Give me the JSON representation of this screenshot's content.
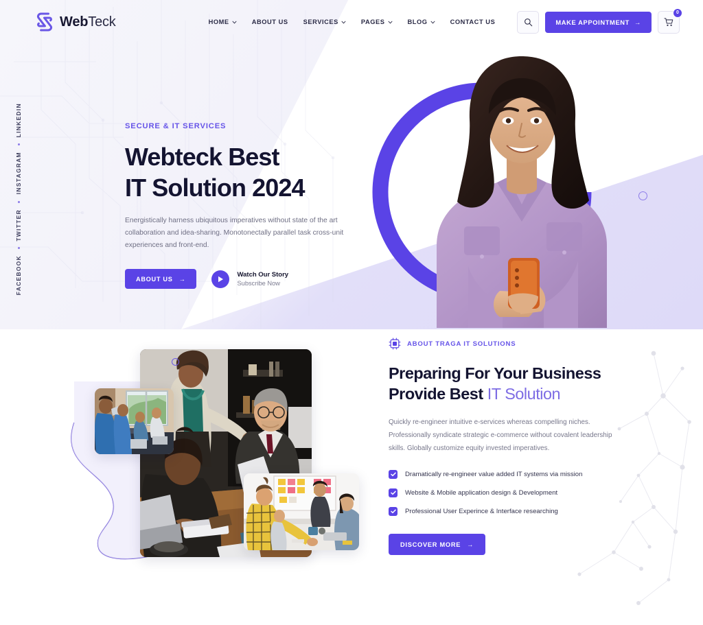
{
  "brand": {
    "name_bold": "Web",
    "name_light": "Teck",
    "logo_icon": "webteck-ribbon-logo",
    "accent": "#5a43e6",
    "accent_light": "#7d6ce4"
  },
  "header": {
    "nav": [
      {
        "label": "HOME",
        "has_caret": true
      },
      {
        "label": "ABOUT US",
        "has_caret": false
      },
      {
        "label": "SERVICES",
        "has_caret": true
      },
      {
        "label": "PAGES",
        "has_caret": true
      },
      {
        "label": "BLOG",
        "has_caret": true
      },
      {
        "label": "CONTACT US",
        "has_caret": false
      }
    ],
    "search_icon": "search-icon",
    "appointment_label": "MAKE APPOINTMENT",
    "appointment_arrow": "→",
    "cart_icon": "shopping-cart-icon",
    "cart_count": "0"
  },
  "social_rail": [
    {
      "label": "LINKEDIN"
    },
    {
      "label": "INSTAGRAM"
    },
    {
      "label": "TWITTER"
    },
    {
      "label": "FACEBOOK"
    }
  ],
  "hero": {
    "eyebrow": "SECURE & IT SERVICES",
    "title_line1": "Webteck Best",
    "title_line2": "IT Solution 2024",
    "subtitle": "Energistically harness ubiquitous imperatives without state of the art collaboration and idea-sharing. Monotonectally parallel task cross-unit experiences and front-end.",
    "cta_label": "ABOUT US",
    "cta_arrow": "→",
    "watch_title": "Watch Our Story",
    "watch_sub": "Subscribe Now",
    "play_icon": "play-icon",
    "image_alt": "smiling-woman-holding-phone"
  },
  "about": {
    "badge_icon": "cpu-chip-icon",
    "badge_label": "ABOUT TRAGA IT SOLUTIONS",
    "title_line1": "Preparing For Your Business",
    "title_line2_bold": "Provide Best ",
    "title_line2_accent": "IT Solution",
    "paragraph": "Quickly re-engineer intuitive e-services whereas compelling niches. Professionally syndicate strategic e-commerce without covalent leadership skills. Globally customize equity invested imperatives.",
    "checklist": [
      "Dramatically re-engineer value added IT systems via mission",
      "Website & Mobile application design & Development",
      "Professional User Experince & Interface researching"
    ],
    "cta_label": "DISCOVER MORE",
    "cta_arrow": "→",
    "images": [
      {
        "alt": "team-meeting-office-main"
      },
      {
        "alt": "students-classroom-computers"
      },
      {
        "alt": "workshop-sticky-notes-whiteboard"
      }
    ]
  }
}
